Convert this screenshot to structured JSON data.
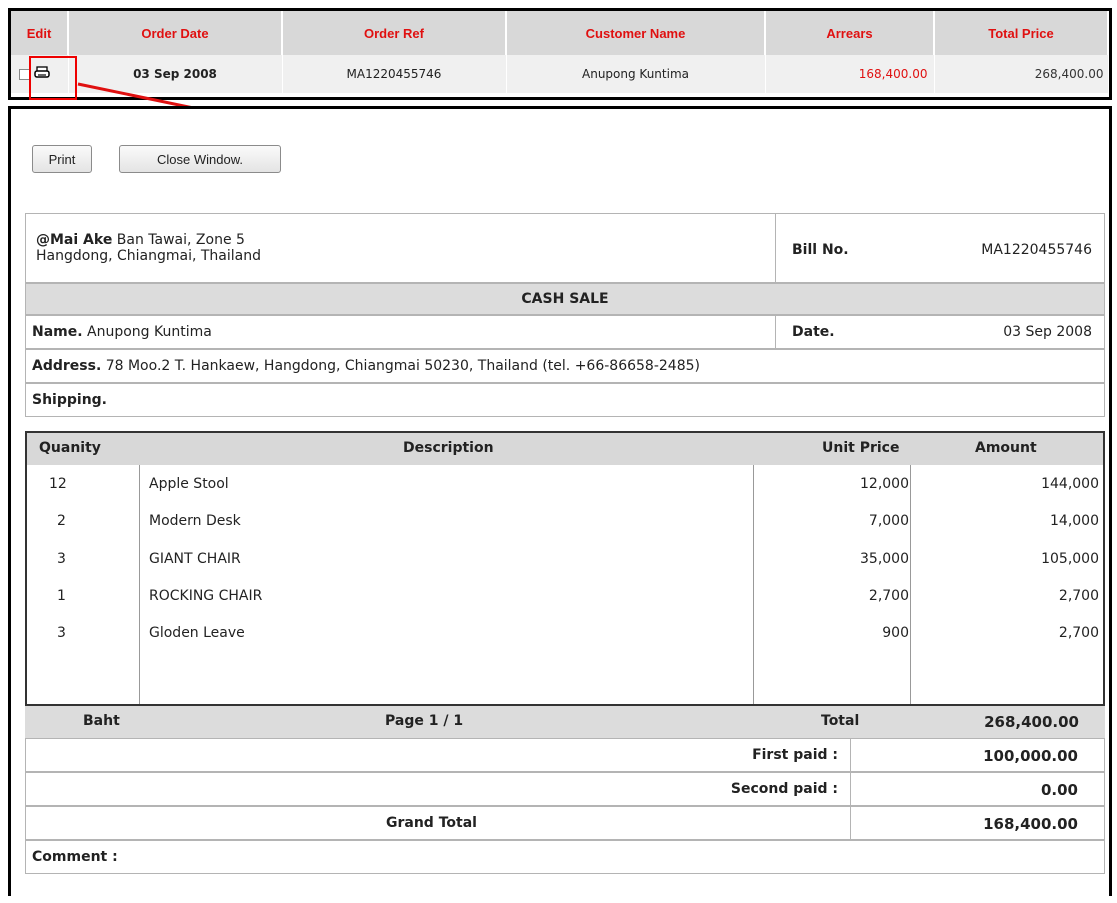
{
  "order_table": {
    "headers": {
      "edit": "Edit",
      "order_date": "Order Date",
      "order_ref": "Order Ref",
      "customer_name": "Customer Name",
      "arrears": "Arrears",
      "total_price": "Total Price"
    },
    "row": {
      "order_date": "03 Sep 2008",
      "order_ref": "MA1220455746",
      "customer_name": "Anupong  Kuntima",
      "arrears": "168,400.00",
      "total_price": "268,400.00"
    }
  },
  "buttons": {
    "print": "Print",
    "close": "Close Window."
  },
  "bill": {
    "company_name": "@Mai Ake",
    "company_addr1": " Ban Tawai, Zone 5",
    "company_addr2": "Hangdong, Chiangmai, Thailand",
    "bill_no_label": "Bill No.",
    "bill_no": "MA1220455746",
    "sale_type": "CASH SALE",
    "name_label": "Name.",
    "name": " Anupong  Kuntima",
    "date_label": "Date.",
    "date": "03 Sep 2008",
    "address_label": "Address.",
    "address": " 78 Moo.2 T. Hankaew, Hangdong, Chiangmai 50230, Thailand (tel. +66-86658-2485)",
    "shipping_label": "Shipping.",
    "item_headers": {
      "qty": "Quanity",
      "desc": "Description",
      "unit": "Unit Price",
      "amount": "Amount"
    },
    "items": [
      {
        "qty": "12",
        "desc": "Apple Stool",
        "unit": "12,000",
        "amount": "144,000"
      },
      {
        "qty": "2",
        "desc": "Modern Desk",
        "unit": "7,000",
        "amount": "14,000"
      },
      {
        "qty": "3",
        "desc": "GIANT CHAIR",
        "unit": "35,000",
        "amount": "105,000"
      },
      {
        "qty": "1",
        "desc": "ROCKING CHAIR",
        "unit": "2,700",
        "amount": "2,700"
      },
      {
        "qty": "3",
        "desc": "Gloden Leave",
        "unit": "900",
        "amount": "2,700"
      }
    ],
    "currency": "Baht",
    "page": "Page 1 / 1",
    "total_label": "Total",
    "total": "268,400.00",
    "first_paid_label": "First paid :",
    "first_paid": "100,000.00",
    "second_paid_label": "Second paid :",
    "second_paid": "0.00",
    "grand_total_label": "Grand Total",
    "grand_total": "168,400.00",
    "comment_label": "Comment :"
  },
  "colors": {
    "accent_red": "#e01010",
    "header_gray": "#d8d8d8"
  },
  "icons": {
    "print": "printer-icon",
    "edit": "checkbox-icon"
  }
}
